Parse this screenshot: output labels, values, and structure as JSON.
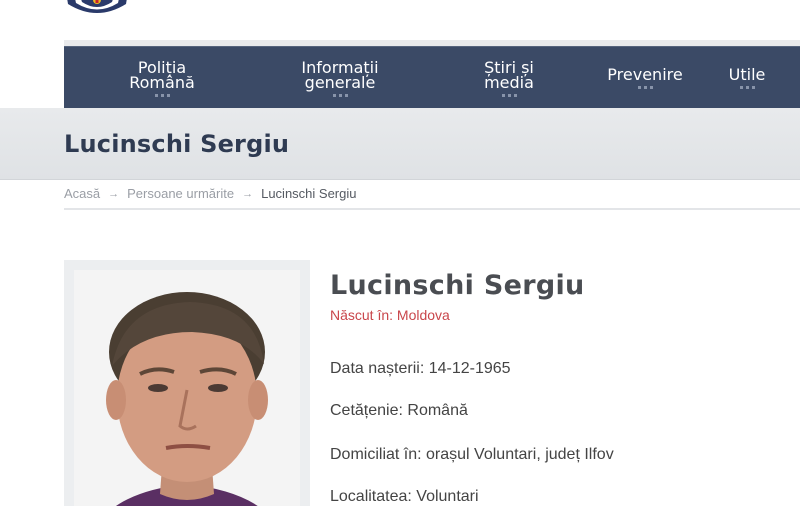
{
  "nav": {
    "items": [
      {
        "label": "Poliția\nRomână"
      },
      {
        "label": "Informații\ngenerale"
      },
      {
        "label": "Știri și\nmedia"
      },
      {
        "label": "Prevenire"
      },
      {
        "label": "Utile"
      }
    ]
  },
  "page": {
    "title": "Lucinschi Sergiu"
  },
  "breadcrumb": {
    "home": "Acasă",
    "section": "Persoane urmărite",
    "current": "Lucinschi Sergiu"
  },
  "person": {
    "name": "Lucinschi Sergiu",
    "born_in": "Născut în: Moldova",
    "fields": [
      {
        "text": "Data nașterii: 14-12-1965"
      },
      {
        "text": "Cetățenie: Română"
      },
      {
        "text": "Domiciliat în: orașul Voluntari, județ Ilfov"
      },
      {
        "text": "Localitatea: Voluntari"
      }
    ]
  },
  "colors": {
    "navbar": "#3b4a66",
    "title_text": "#2f3b52",
    "accent_red": "#c9464b"
  },
  "icons": {
    "logo": "police-badge-logo",
    "breadcrumb_separator": "arrow-right-icon"
  }
}
